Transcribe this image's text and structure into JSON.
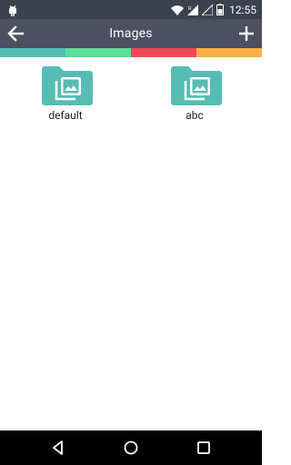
{
  "status_bar": {
    "time": "12:55"
  },
  "toolbar": {
    "title": "Images"
  },
  "colors": {
    "teal": "#56bdb4",
    "green": "#5edc9a",
    "red": "#ee4858",
    "orange": "#f6b047"
  },
  "folders": [
    {
      "label": "default",
      "icon": "image-folder-icon"
    },
    {
      "label": "abc",
      "icon": "image-folder-icon"
    }
  ]
}
